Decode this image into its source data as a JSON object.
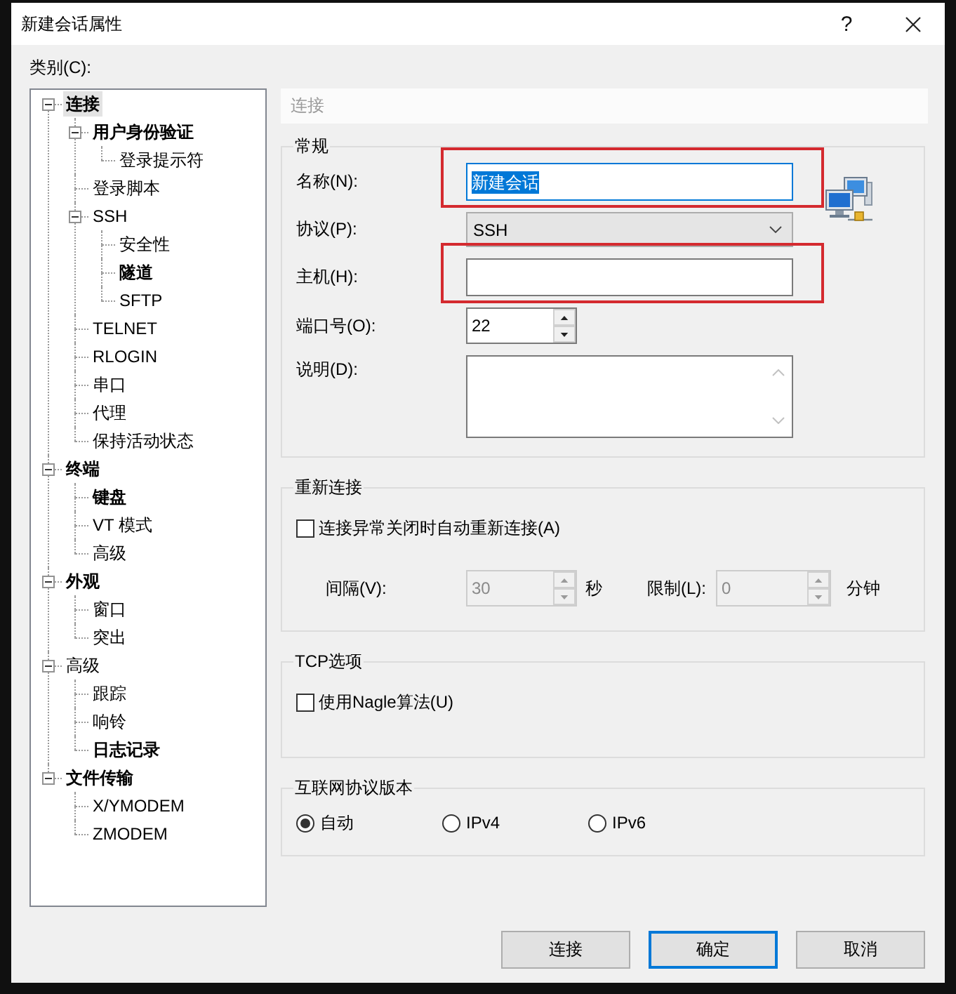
{
  "window": {
    "title": "新建会话属性",
    "help": "?"
  },
  "category_label": "类别(C):",
  "category_tree": [
    {
      "label": "连接",
      "bold": true,
      "selected": true,
      "expanded": true,
      "children": [
        {
          "label": "用户身份验证",
          "bold": true,
          "selected": false,
          "expanded": true,
          "children": [
            {
              "label": "登录提示符",
              "bold": false,
              "selected": false
            }
          ]
        },
        {
          "label": "登录脚本",
          "bold": false,
          "selected": false
        },
        {
          "label": "SSH",
          "bold": false,
          "selected": false,
          "expanded": true,
          "children": [
            {
              "label": "安全性",
              "bold": false,
              "selected": false
            },
            {
              "label": "隧道",
              "bold": true,
              "selected": false
            },
            {
              "label": "SFTP",
              "bold": false,
              "selected": false
            }
          ]
        },
        {
          "label": "TELNET",
          "bold": false,
          "selected": false
        },
        {
          "label": "RLOGIN",
          "bold": false,
          "selected": false
        },
        {
          "label": "串口",
          "bold": false,
          "selected": false
        },
        {
          "label": "代理",
          "bold": false,
          "selected": false
        },
        {
          "label": "保持活动状态",
          "bold": false,
          "selected": false
        }
      ]
    },
    {
      "label": "终端",
      "bold": true,
      "selected": false,
      "expanded": true,
      "children": [
        {
          "label": "键盘",
          "bold": true,
          "selected": false
        },
        {
          "label": "VT 模式",
          "bold": false,
          "selected": false
        },
        {
          "label": "高级",
          "bold": false,
          "selected": false
        }
      ]
    },
    {
      "label": "外观",
      "bold": true,
      "selected": false,
      "expanded": true,
      "children": [
        {
          "label": "窗口",
          "bold": false,
          "selected": false
        },
        {
          "label": "突出",
          "bold": false,
          "selected": false
        }
      ]
    },
    {
      "label": "高级",
      "bold": false,
      "selected": false,
      "expanded": true,
      "children": [
        {
          "label": "跟踪",
          "bold": false,
          "selected": false
        },
        {
          "label": "响铃",
          "bold": false,
          "selected": false
        },
        {
          "label": "日志记录",
          "bold": true,
          "selected": false
        }
      ]
    },
    {
      "label": "文件传输",
      "bold": true,
      "selected": false,
      "expanded": true,
      "children": [
        {
          "label": "X/YMODEM",
          "bold": false,
          "selected": false
        },
        {
          "label": "ZMODEM",
          "bold": false,
          "selected": false
        }
      ]
    }
  ],
  "page_header": "连接",
  "general": {
    "title": "常规",
    "fields": [
      {
        "kind": "text",
        "label": "名称(N):",
        "value": "新建会话",
        "focused": true,
        "highlighted": true
      },
      {
        "kind": "select",
        "label": "协议(P):",
        "value": "SSH",
        "focused": false,
        "highlighted": false
      },
      {
        "kind": "text",
        "label": "主机(H):",
        "focused": false,
        "highlighted": true
      },
      {
        "kind": "spin",
        "label": "端口号(O):",
        "value": "22",
        "focused": false,
        "highlighted": false
      },
      {
        "kind": "textarea",
        "label": "说明(D):",
        "focused": false,
        "highlighted": false
      }
    ]
  },
  "reconnect": {
    "title": "重新连接",
    "checkbox": {
      "label": "连接异常关闭时自动重新连接(A)",
      "checked": false
    },
    "settings": [
      {
        "label": "间隔(V):",
        "value": "30",
        "unit": "秒",
        "disabled": true
      },
      {
        "label": "限制(L):",
        "value": "0",
        "unit": "分钟",
        "disabled": true
      }
    ]
  },
  "tcp": {
    "title": "TCP选项",
    "checkbox": {
      "label": "使用Nagle算法(U)",
      "checked": false
    }
  },
  "ip_version": {
    "title": "互联网协议版本",
    "options": [
      {
        "label": "自动",
        "selected": true
      },
      {
        "label": "IPv4",
        "selected": false
      },
      {
        "label": "IPv6",
        "selected": false
      }
    ]
  },
  "buttons": [
    {
      "label": "连接",
      "default": false
    },
    {
      "label": "确定",
      "default": true
    },
    {
      "label": "取消",
      "default": false
    }
  ]
}
